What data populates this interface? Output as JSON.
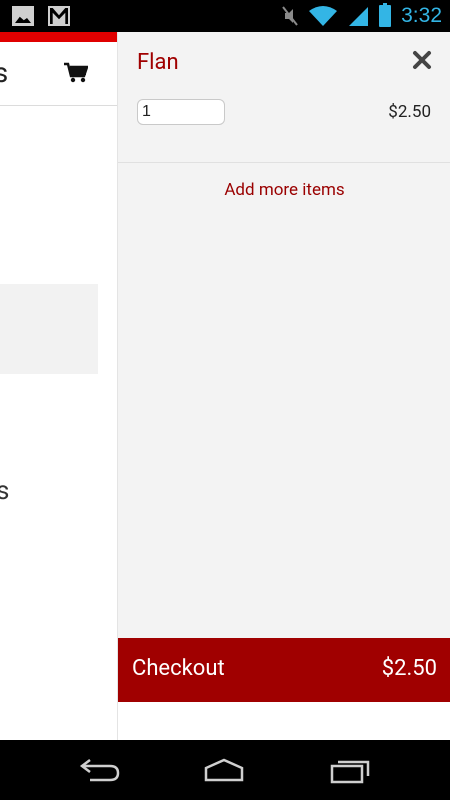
{
  "status_bar": {
    "time": "3:32",
    "icons": [
      "image-icon",
      "gmail-icon",
      "mute-icon",
      "wifi-icon",
      "signal-icon",
      "battery-icon"
    ],
    "accent_color": "#33b5e5"
  },
  "background_page": {
    "title_fragment": "'s",
    "text_fragment": "s",
    "accent_color": "#e00000"
  },
  "cart": {
    "item": {
      "name": "Flan",
      "quantity": "1",
      "price": "$2.50"
    },
    "add_more_label": "Add more items",
    "checkout_label": "Checkout",
    "total": "$2.50",
    "brand_color": "#a00000"
  },
  "nav_bar": {
    "buttons": [
      "back-icon",
      "home-icon",
      "recent-apps-icon"
    ]
  }
}
